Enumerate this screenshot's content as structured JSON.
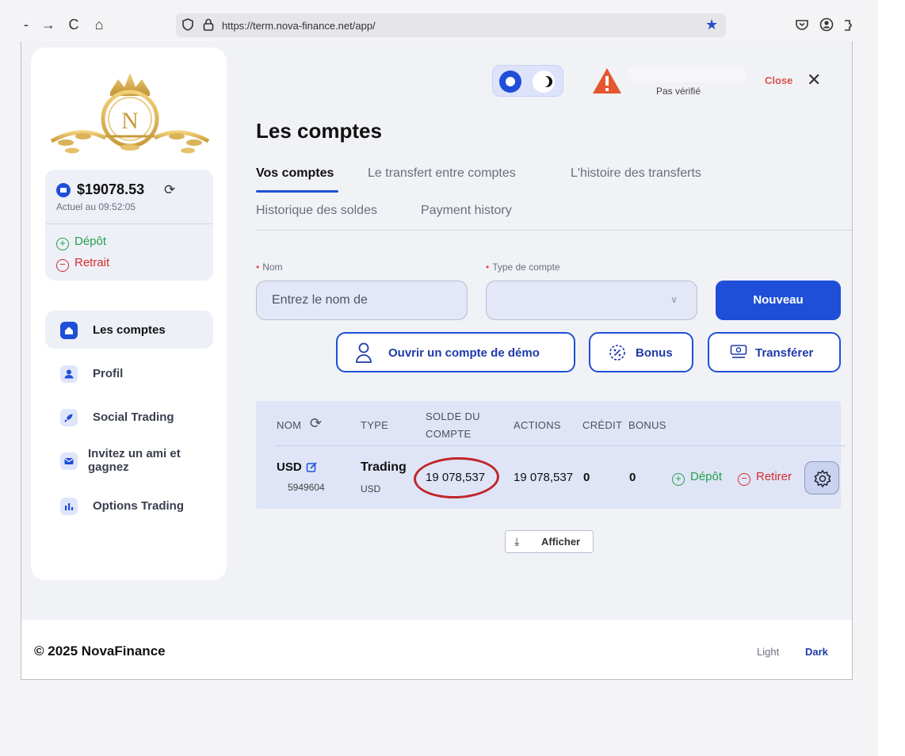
{
  "browser": {
    "nav": {
      "forward": "→",
      "reload": "C",
      "home": "⌂",
      "back": "-"
    },
    "url": "https://term.nova-finance.net/app/"
  },
  "sidebar": {
    "balance": {
      "amount": "$19078.53",
      "updated": "Actuel au 09:52:05",
      "deposit_label": "Dépôt",
      "withdraw_label": "Retrait"
    },
    "menu": [
      {
        "label": "Les comptes",
        "icon": "home-icon",
        "active": true
      },
      {
        "label": "Profil",
        "icon": "user-icon"
      },
      {
        "label": "Social Trading",
        "icon": "rocket-icon"
      },
      {
        "label": "Invitez un ami et gagnez",
        "icon": "mail-icon"
      },
      {
        "label": "Options Trading",
        "icon": "bar-chart-icon"
      }
    ]
  },
  "header": {
    "user_status": "Pas vérifié",
    "close_label": "Close"
  },
  "main": {
    "title": "Les comptes",
    "tabs": [
      {
        "label": "Vos comptes",
        "active": true
      },
      {
        "label": "Le transfert entre comptes"
      },
      {
        "label": "L'histoire des transferts"
      },
      {
        "label": "Historique des soldes"
      },
      {
        "label": "Payment history"
      }
    ],
    "form": {
      "name_label": "Nom",
      "name_placeholder": "Entrez le nom de",
      "type_label": "Type de compte",
      "type_value": "",
      "new_button": "Nouveau"
    },
    "actions": {
      "demo_button": "Ouvrir un compte de démo",
      "bonus_button": "Bonus",
      "transfer_button": "Transférer"
    },
    "table": {
      "headers": {
        "name": "NOM",
        "type": "TYPE",
        "balance_line1": "SOLDE DU",
        "balance_line2": "COMPTE",
        "actions": "ACTIONS",
        "credit": "CRÉDIT",
        "bonus": "BONUS"
      },
      "rows": [
        {
          "currency": "USD",
          "account_id": "5949604",
          "type": "Trading",
          "type_sub": "USD",
          "balance": "19 078,537",
          "actions": "19 078,537",
          "credit": "0",
          "bonus": "0",
          "deposit": "Dépôt",
          "withdraw": "Retirer"
        }
      ]
    },
    "show_button": "Afficher"
  },
  "footer": {
    "copyright": "© 2025 NovaFinance",
    "light_label": "Light",
    "dark_label": "Dark"
  },
  "colors": {
    "accent": "#1f4fd8",
    "deposit": "#23a04a",
    "withdraw": "#d42c2c",
    "annotation": "#c0262a"
  }
}
